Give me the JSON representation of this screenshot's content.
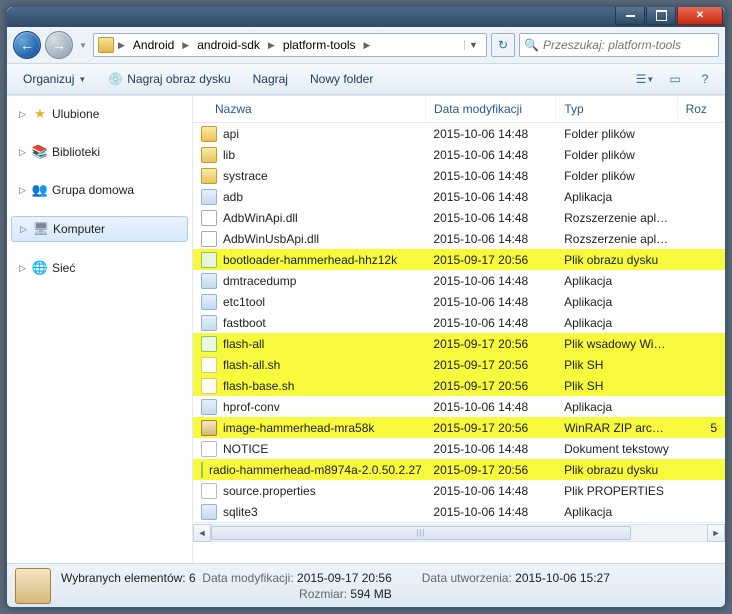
{
  "breadcrumbs": [
    "Android",
    "android-sdk",
    "platform-tools"
  ],
  "search_placeholder": "Przeszukaj: platform-tools",
  "toolbar": {
    "organize": "Organizuj",
    "burn": "Nagraj obraz dysku",
    "burn2": "Nagraj",
    "newfolder": "Nowy folder"
  },
  "tree": {
    "favorites": "Ulubione",
    "libraries": "Biblioteki",
    "homegroup": "Grupa domowa",
    "computer": "Komputer",
    "network": "Sieć"
  },
  "columns": {
    "name": "Nazwa",
    "date": "Data modyfikacji",
    "type": "Typ",
    "size": "Roz"
  },
  "files": [
    {
      "name": "api",
      "date": "2015-10-06 14:48",
      "type": "Folder plików",
      "icon": "folder",
      "hl": false
    },
    {
      "name": "lib",
      "date": "2015-10-06 14:48",
      "type": "Folder plików",
      "icon": "folder",
      "hl": false
    },
    {
      "name": "systrace",
      "date": "2015-10-06 14:48",
      "type": "Folder plików",
      "icon": "folder",
      "hl": false
    },
    {
      "name": "adb",
      "date": "2015-10-06 14:48",
      "type": "Aplikacja",
      "icon": "app",
      "hl": false
    },
    {
      "name": "AdbWinApi.dll",
      "date": "2015-10-06 14:48",
      "type": "Rozszerzenie aplik...",
      "icon": "dll",
      "hl": false
    },
    {
      "name": "AdbWinUsbApi.dll",
      "date": "2015-10-06 14:48",
      "type": "Rozszerzenie aplik...",
      "icon": "dll",
      "hl": false
    },
    {
      "name": "bootloader-hammerhead-hhz12k",
      "date": "2015-09-17 20:56",
      "type": "Plik obrazu dysku",
      "icon": "img",
      "hl": true
    },
    {
      "name": "dmtracedump",
      "date": "2015-10-06 14:48",
      "type": "Aplikacja",
      "icon": "app",
      "hl": false
    },
    {
      "name": "etc1tool",
      "date": "2015-10-06 14:48",
      "type": "Aplikacja",
      "icon": "app",
      "hl": false
    },
    {
      "name": "fastboot",
      "date": "2015-10-06 14:48",
      "type": "Aplikacja",
      "icon": "app",
      "hl": false
    },
    {
      "name": "flash-all",
      "date": "2015-09-17 20:56",
      "type": "Plik wsadowy Win...",
      "icon": "bat",
      "hl": true
    },
    {
      "name": "flash-all.sh",
      "date": "2015-09-17 20:56",
      "type": "Plik SH",
      "icon": "sh",
      "hl": true
    },
    {
      "name": "flash-base.sh",
      "date": "2015-09-17 20:56",
      "type": "Plik SH",
      "icon": "sh",
      "hl": true
    },
    {
      "name": "hprof-conv",
      "date": "2015-10-06 14:48",
      "type": "Aplikacja",
      "icon": "app",
      "hl": false
    },
    {
      "name": "image-hammerhead-mra58k",
      "date": "2015-09-17 20:56",
      "type": "WinRAR ZIP archive",
      "icon": "rar",
      "hl": true,
      "size": "5"
    },
    {
      "name": "NOTICE",
      "date": "2015-10-06 14:48",
      "type": "Dokument tekstowy",
      "icon": "txt",
      "hl": false
    },
    {
      "name": "radio-hammerhead-m8974a-2.0.50.2.27",
      "date": "2015-09-17 20:56",
      "type": "Plik obrazu dysku",
      "icon": "img",
      "hl": true
    },
    {
      "name": "source.properties",
      "date": "2015-10-06 14:48",
      "type": "Plik PROPERTIES",
      "icon": "txt",
      "hl": false
    },
    {
      "name": "sqlite3",
      "date": "2015-10-06 14:48",
      "type": "Aplikacja",
      "icon": "app",
      "hl": false
    }
  ],
  "status": {
    "selection": "Wybranych elementów: 6",
    "mod_lbl": "Data modyfikacji:",
    "mod_val": "2015-09-17 20:56",
    "cre_lbl": "Data utworzenia:",
    "cre_val": "2015-10-06 15:27",
    "size_lbl": "Rozmiar:",
    "size_val": "594 MB"
  }
}
